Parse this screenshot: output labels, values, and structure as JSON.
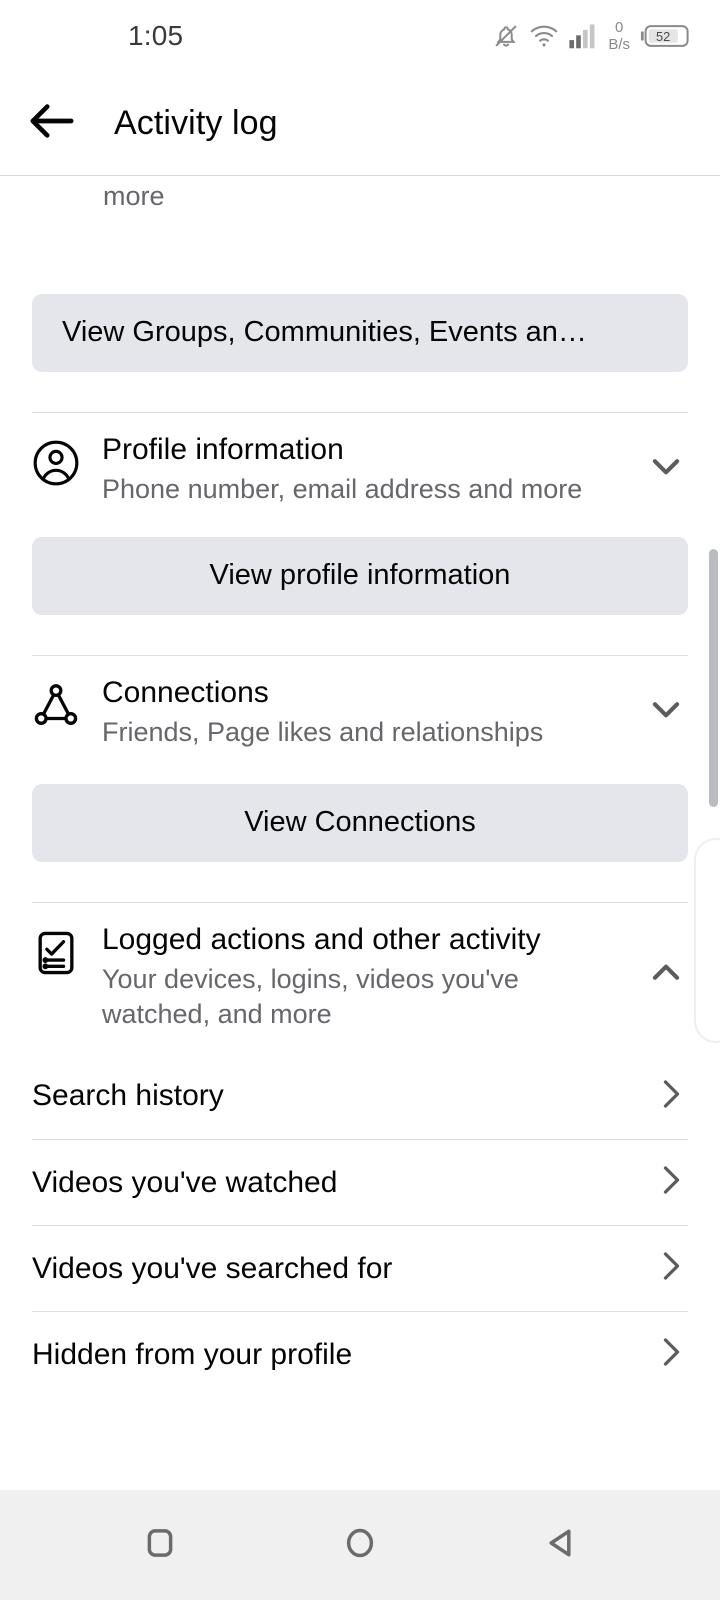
{
  "statusbar": {
    "time": "1:05",
    "netspeed_value": "0",
    "netspeed_unit": "B/s",
    "battery_level": "52",
    "icons": [
      "bell-slash-icon",
      "wifi-icon",
      "signal-bars-icon",
      "network-speed-indicator",
      "battery-icon"
    ]
  },
  "appbar": {
    "back_label": "back-arrow",
    "title": "Activity log"
  },
  "content": {
    "overflow_text": "more",
    "sections": [
      {
        "cta_label": "View Groups, Communities, Events an…",
        "cta_align": "left"
      },
      {
        "icon": "profile-circle-icon",
        "title": "Profile information",
        "subtitle": "Phone number, email address and more",
        "chevron": "chevron-down-icon",
        "expanded": false,
        "cta_label": "View profile information"
      },
      {
        "icon": "connections-network-icon",
        "title": "Connections",
        "subtitle": "Friends, Page likes and relationships",
        "chevron": "chevron-down-icon",
        "expanded": false,
        "cta_label": "View Connections"
      },
      {
        "icon": "checklist-clipboard-icon",
        "title": "Logged actions and other activity",
        "subtitle": "Your devices, logins, videos you've watched, and more",
        "chevron": "chevron-up-icon",
        "expanded": true,
        "items": [
          {
            "label": "Search history",
            "chevron": "chevron-right-icon"
          },
          {
            "label": "Videos you've watched",
            "chevron": "chevron-right-icon"
          },
          {
            "label": "Videos you've searched for",
            "chevron": "chevron-right-icon"
          },
          {
            "label": "Hidden from your profile",
            "chevron": "chevron-right-icon"
          }
        ]
      }
    ]
  },
  "navbar": {
    "recents_label": "recents-square-icon",
    "home_label": "home-circle-icon",
    "back_label": "back-triangle-icon"
  },
  "colors": {
    "page_bg": "#ffffff",
    "button_bg": "#e4e6eb",
    "primary_text": "#050505",
    "secondary_text": "#65676b",
    "divider": "#dcdfe3",
    "navbar_bg": "#f0f0f0",
    "scrollbar": "#b9bcc0"
  }
}
